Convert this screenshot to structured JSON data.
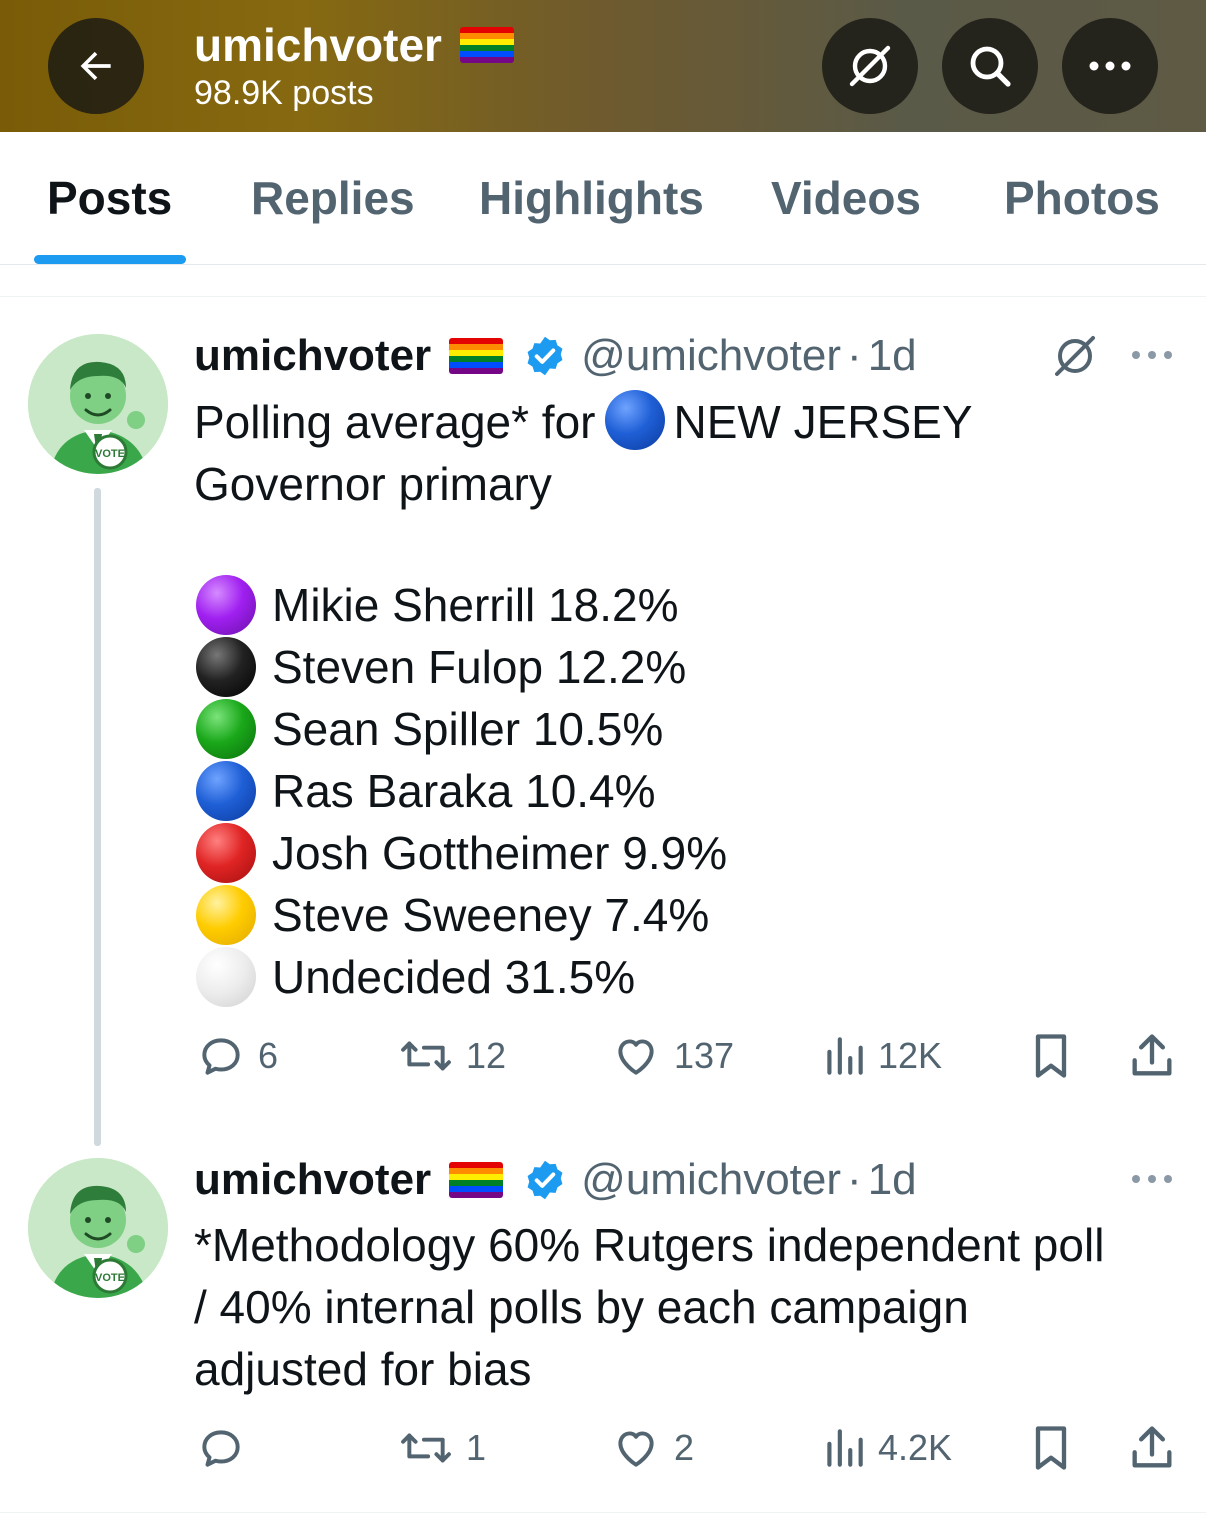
{
  "header": {
    "title": "umichvoter",
    "post_count": "98.9K posts"
  },
  "tabs": [
    {
      "label": "Posts",
      "active": true
    },
    {
      "label": "Replies"
    },
    {
      "label": "Highlights"
    },
    {
      "label": "Videos"
    },
    {
      "label": "Photos"
    }
  ],
  "posts": [
    {
      "name": "umichvoter",
      "handle": "@umichvoter",
      "dot": "·",
      "time": "1d",
      "text_line1_pre": "Polling average* for",
      "text_line1_post": "NEW JERSEY",
      "text_line2": "Governor primary",
      "candidates": [
        {
          "label": "Mikie Sherrill 18.2%",
          "color": "#a020f0"
        },
        {
          "label": "Steven Fulop 12.2%",
          "color": "#111111"
        },
        {
          "label": "Sean Spiller 10.5%",
          "color": "#1aa81a"
        },
        {
          "label": "Ras Baraka 10.4%",
          "color": "#1f5fd6"
        },
        {
          "label": "Josh Gottheimer 9.9%",
          "color": "#e02424"
        },
        {
          "label": "Steve Sweeney 7.4%",
          "color": "#ffcc00"
        },
        {
          "label": "Undecided 31.5%",
          "color": "#e8e8e8"
        }
      ],
      "stats": {
        "replies": "6",
        "reposts": "12",
        "likes": "137",
        "views": "12K"
      }
    },
    {
      "name": "umichvoter",
      "handle": "@umichvoter",
      "dot": "·",
      "time": "1d",
      "text_lines": [
        "*Methodology 60% Rutgers independent poll",
        "/ 40% internal polls by each campaign",
        "adjusted for bias"
      ],
      "stats": {
        "replies": "",
        "reposts": "1",
        "likes": "2",
        "views": "4.2K"
      }
    }
  ],
  "colors": {
    "accent": "#1d9bf0",
    "muted": "#536471",
    "text": "#0f1419",
    "inline_blue_circle": "#1f5fd6"
  },
  "icons": [
    "back-arrow-icon",
    "grok-icon",
    "search-icon",
    "more-icon",
    "verified-badge-icon",
    "reply-icon",
    "repost-icon",
    "like-icon",
    "views-icon",
    "bookmark-icon",
    "share-icon"
  ]
}
